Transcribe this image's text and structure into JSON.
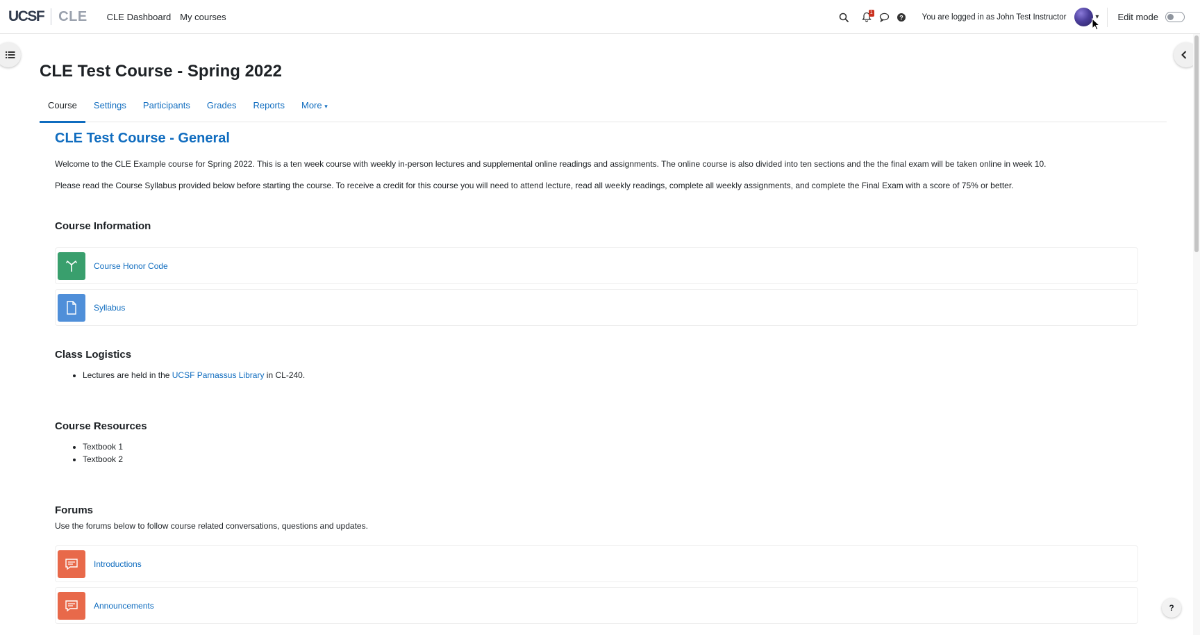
{
  "brand": {
    "primary": "UCSF",
    "secondary": "CLE"
  },
  "nav": {
    "links": [
      "CLE Dashboard",
      "My courses"
    ]
  },
  "user_menu": {
    "notification_count": "1",
    "login_text": "You are logged in as John Test Instructor",
    "edit_mode_label": "Edit mode",
    "edit_mode_on": false
  },
  "course": {
    "title": "CLE Test Course - Spring 2022",
    "tabs": [
      "Course",
      "Settings",
      "Participants",
      "Grades",
      "Reports",
      "More"
    ],
    "active_tab": "Course"
  },
  "section": {
    "title": "CLE Test Course - General",
    "welcome": "Welcome to the CLE Example course for Spring 2022. This is a ten week course with weekly in-person lectures and supplemental online readings and assignments. The online course is also divided into ten sections and the the final exam will be taken online in week 10.",
    "instructions": "Please read the Course Syllabus provided below before starting the course. To receive a credit for this course you will need to attend lecture, read all weekly readings, complete all weekly assignments, and complete the Final Exam with a score of 75% or better."
  },
  "course_info": {
    "heading": "Course Information",
    "activities": [
      {
        "label": "Course Honor Code",
        "icon": "chart-icon",
        "color": "#399f6d"
      },
      {
        "label": "Syllabus",
        "icon": "file-icon",
        "color": "#4f8fd9"
      }
    ]
  },
  "logistics": {
    "heading": "Class Logistics",
    "item_prefix": "Lectures are held in the ",
    "item_link": "UCSF Parnassus Library",
    "item_suffix": " in CL-240."
  },
  "resources": {
    "heading": "Course Resources",
    "items": [
      "Textbook 1",
      "Textbook 2"
    ]
  },
  "forums": {
    "heading": "Forums",
    "description": "Use the forums below to follow course related conversations, questions and updates.",
    "activities": [
      {
        "label": "Introductions",
        "icon": "forum-icon",
        "color": "#e8694a"
      },
      {
        "label": "Announcements",
        "icon": "forum-icon",
        "color": "#e8694a"
      }
    ]
  },
  "help_button": "?"
}
